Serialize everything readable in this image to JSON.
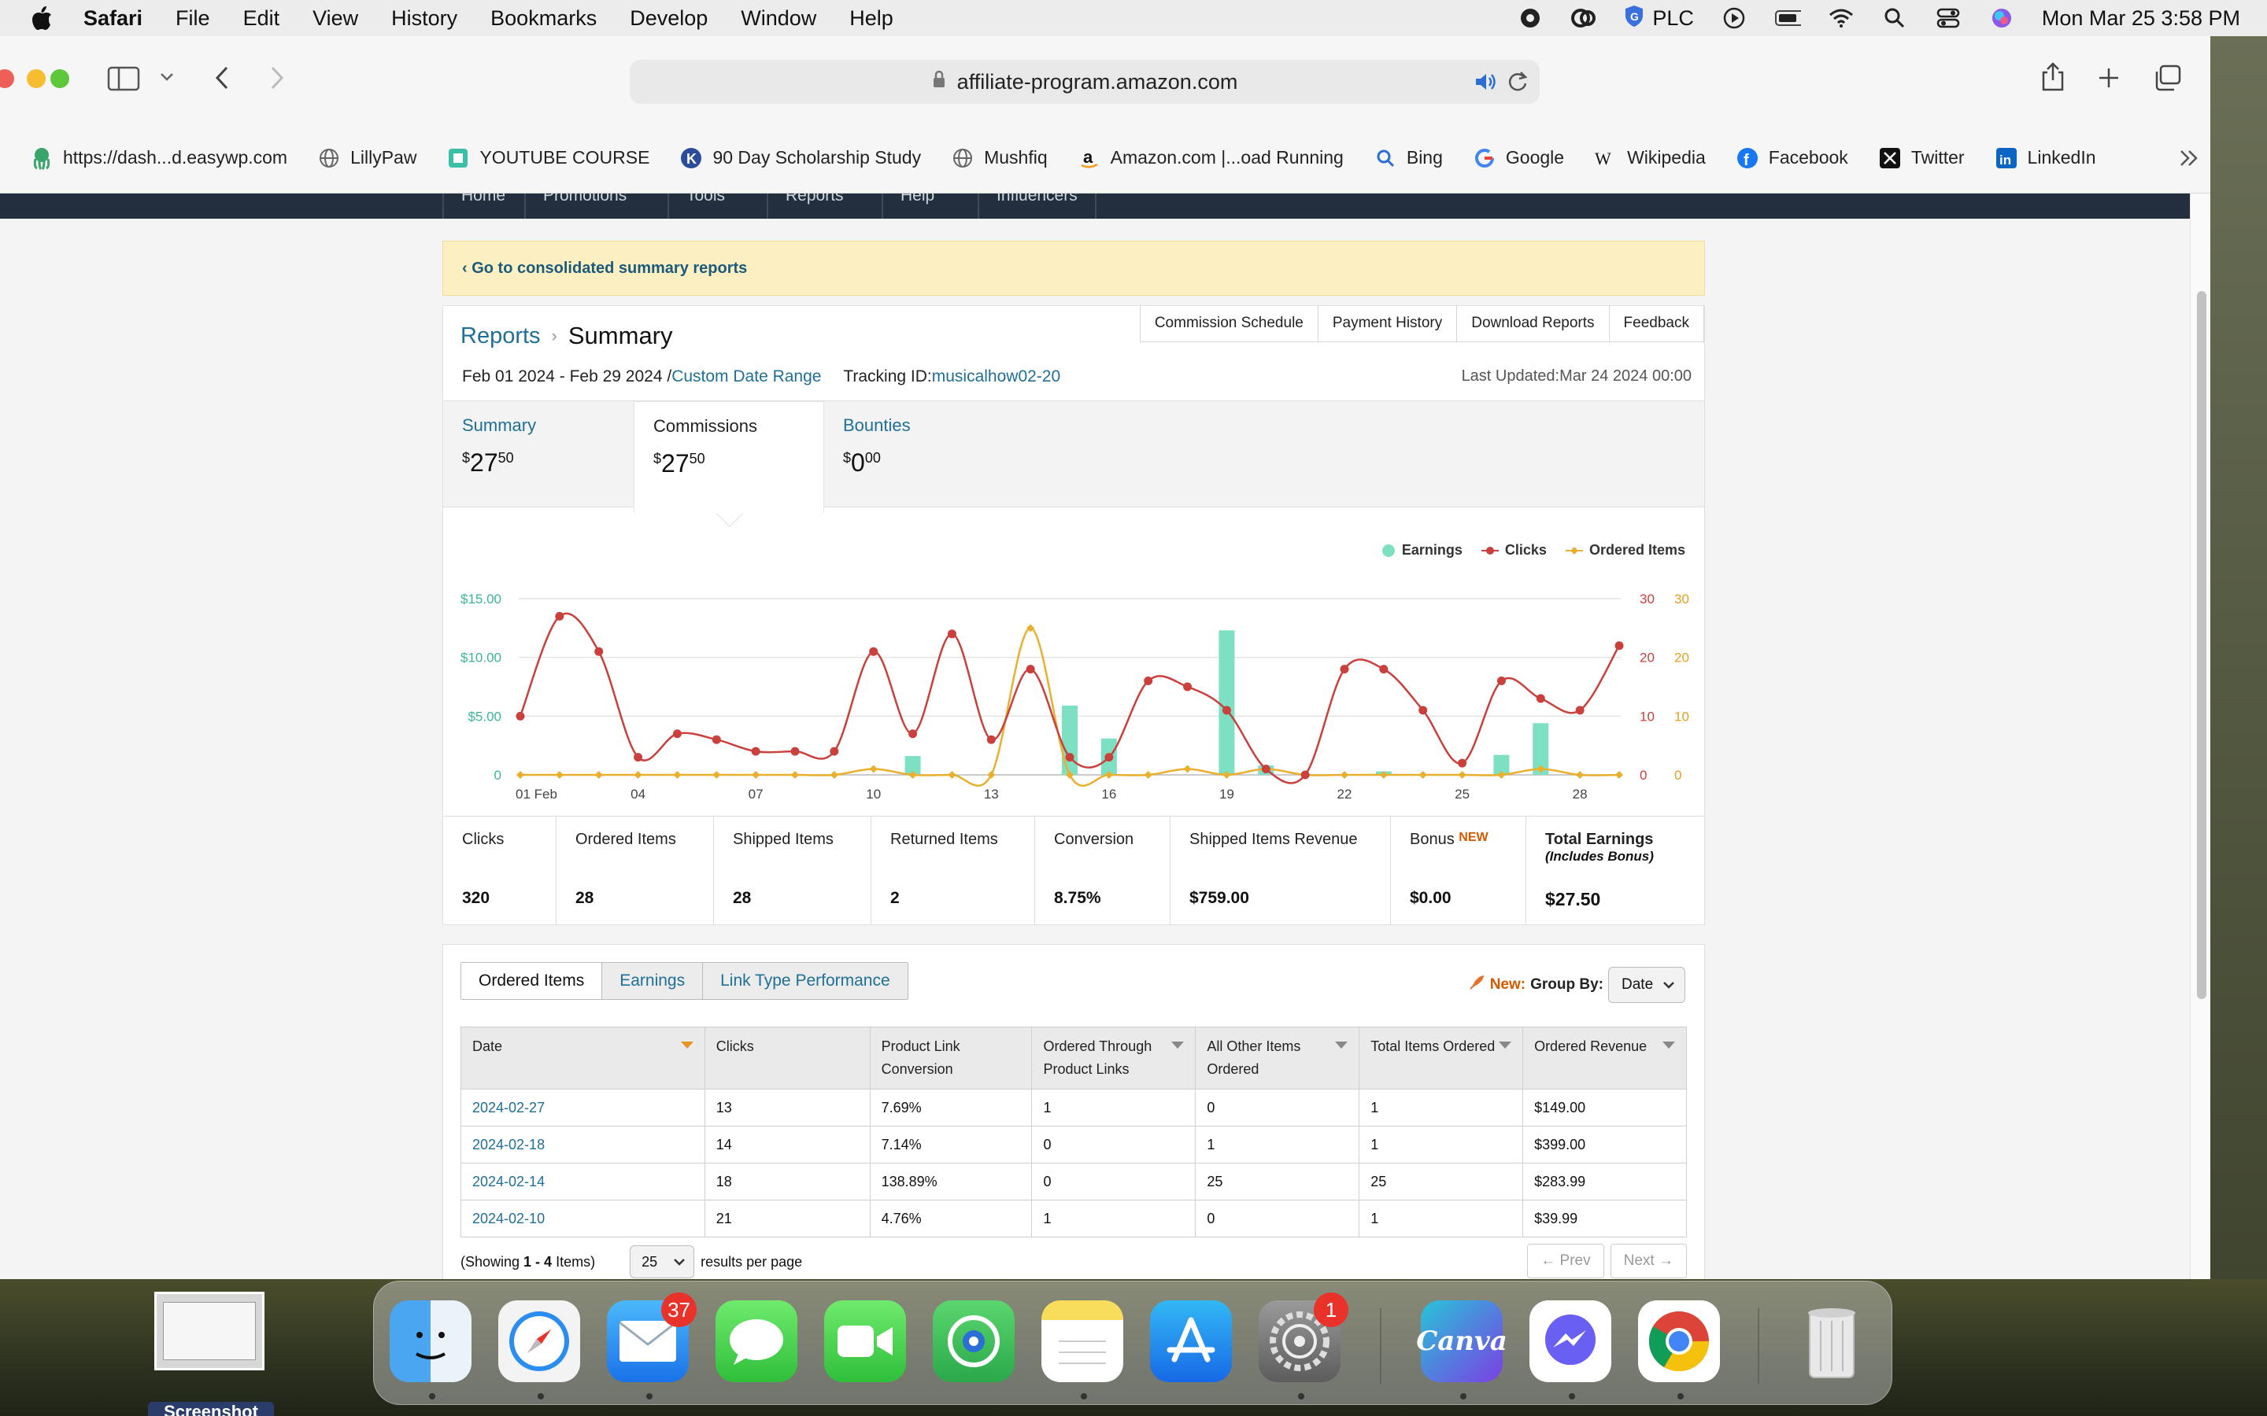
{
  "menubar": {
    "app": "Safari",
    "menus": [
      "File",
      "Edit",
      "View",
      "History",
      "Bookmarks",
      "Develop",
      "Window",
      "Help"
    ],
    "plc_label": "PLC",
    "datetime": "Mon Mar 25  3:58 PM"
  },
  "browser": {
    "url": "affiliate-program.amazon.com",
    "favorites": [
      {
        "label": "https://dash...d.easywp.com",
        "icon": "octopus-icon"
      },
      {
        "label": "LillyPaw",
        "icon": "globe-icon"
      },
      {
        "label": "YOUTUBE COURSE",
        "icon": "bookmark-icon"
      },
      {
        "label": "90 Day Scholarship Study",
        "icon": "k-logo-icon"
      },
      {
        "label": "Mushfiq",
        "icon": "globe-icon"
      },
      {
        "label": "Amazon.com |...oad Running",
        "icon": "amazon-icon"
      },
      {
        "label": "Bing",
        "icon": "search-icon"
      },
      {
        "label": "Google",
        "icon": "google-icon"
      },
      {
        "label": "Wikipedia",
        "icon": "wikipedia-icon"
      },
      {
        "label": "Facebook",
        "icon": "facebook-icon"
      },
      {
        "label": "Twitter",
        "icon": "x-icon"
      },
      {
        "label": "LinkedIn",
        "icon": "linkedin-icon"
      }
    ]
  },
  "nav": [
    "Home",
    "Promotions",
    "Tools",
    "Reports",
    "Help",
    "Influencers"
  ],
  "banner": "‹ Go to consolidated summary reports",
  "report": {
    "crumb_link": "Reports",
    "crumb_current": "Summary",
    "top_buttons": [
      "Commission Schedule",
      "Payment History",
      "Download Reports",
      "Feedback"
    ],
    "date_range": "Feb 01 2024 - Feb 29 2024 /",
    "custom_range": "Custom Date Range",
    "tracking_label": "Tracking ID:",
    "tracking_id": "musicalhow02-20",
    "last_updated": "Last Updated:Mar 24 2024 00:00",
    "tabs": [
      {
        "label": "Summary",
        "dollars": "27",
        "cents": "50"
      },
      {
        "label": "Commissions",
        "dollars": "27",
        "cents": "50"
      },
      {
        "label": "Bounties",
        "dollars": "0",
        "cents": "00"
      }
    ],
    "legend": [
      "Earnings",
      "Clicks",
      "Ordered Items"
    ],
    "metrics": [
      {
        "label": "Clicks",
        "value": "320"
      },
      {
        "label": "Ordered Items",
        "value": "28"
      },
      {
        "label": "Shipped Items",
        "value": "28"
      },
      {
        "label": "Returned Items",
        "value": "2"
      },
      {
        "label": "Conversion",
        "value": "8.75%"
      },
      {
        "label": "Shipped Items Revenue",
        "value": "$759.00"
      },
      {
        "label": "Bonus",
        "badge": "NEW",
        "value": "$0.00"
      },
      {
        "label": "Total Earnings",
        "sub": "(Includes Bonus)",
        "value": "$27.50"
      }
    ]
  },
  "table_panel": {
    "tabs": [
      "Ordered Items",
      "Earnings",
      "Link Type Performance"
    ],
    "new_label": "New:",
    "group_by_label": "Group By:",
    "group_by_value": "Date",
    "headers": [
      "Date",
      "Clicks",
      "Product Link Conversion",
      "Ordered Through Product Links",
      "All Other Items Ordered",
      "Total Items Ordered",
      "Ordered Revenue"
    ],
    "rows": [
      [
        "2024-02-27",
        "13",
        "7.69%",
        "1",
        "0",
        "1",
        "$149.00"
      ],
      [
        "2024-02-18",
        "14",
        "7.14%",
        "0",
        "1",
        "1",
        "$399.00"
      ],
      [
        "2024-02-14",
        "18",
        "138.89%",
        "0",
        "25",
        "25",
        "$283.99"
      ],
      [
        "2024-02-10",
        "21",
        "4.76%",
        "1",
        "0",
        "1",
        "$39.99"
      ]
    ],
    "showing_prefix": "(Showing ",
    "showing_range": "1 - 4",
    "showing_suffix": " Items)",
    "per_page": "25",
    "per_page_label": "results per page",
    "prev": "←  Prev",
    "next": "Next  →"
  },
  "dock": {
    "mail_badge": "37",
    "settings_badge": "1",
    "canva_label": "Canva",
    "screenshot_label": "Screenshot"
  },
  "chart_data": {
    "type": "bar+line",
    "x": [
      "01 Feb",
      "02",
      "03",
      "04",
      "05",
      "06",
      "07",
      "08",
      "09",
      "10",
      "11",
      "12",
      "13",
      "14",
      "15",
      "16",
      "17",
      "18",
      "19",
      "20",
      "21",
      "22",
      "23",
      "24",
      "25",
      "26",
      "27",
      "28",
      "29"
    ],
    "xtick_labels": [
      "01 Feb",
      "04",
      "07",
      "10",
      "13",
      "16",
      "19",
      "22",
      "25",
      "28"
    ],
    "y_left_ticks": [
      "$15.00",
      "$10.00",
      "$5.00",
      "0"
    ],
    "y_right_ticks": [
      "30",
      "20",
      "10",
      "0"
    ],
    "ylim_left": [
      0,
      15
    ],
    "ylim_right": [
      0,
      30
    ],
    "series": [
      {
        "name": "Earnings",
        "type": "bar",
        "axis": "left",
        "color": "#7de0c3",
        "values": [
          0,
          0,
          0,
          0,
          0,
          0,
          0,
          0,
          0,
          0,
          1.6,
          0,
          0,
          0,
          5.9,
          3.1,
          0,
          0,
          12.3,
          0.8,
          0,
          0,
          0.3,
          0,
          0,
          1.7,
          4.4,
          0,
          0
        ]
      },
      {
        "name": "Clicks",
        "type": "line",
        "axis": "right",
        "color": "#c9403c",
        "values": [
          10,
          27,
          21,
          3,
          7,
          6,
          4,
          4,
          4,
          21,
          7,
          24,
          6,
          18,
          3,
          3,
          16,
          15,
          11,
          1,
          0,
          18,
          18,
          11,
          2,
          16,
          13,
          11,
          22
        ]
      },
      {
        "name": "Ordered Items",
        "type": "line",
        "axis": "right",
        "color": "#e9b030",
        "values": [
          0,
          0,
          0,
          0,
          0,
          0,
          0,
          0,
          0,
          1,
          0,
          0,
          0,
          25,
          0,
          0,
          0,
          1,
          0,
          1,
          0,
          0,
          0,
          0,
          0,
          0,
          1,
          0,
          0
        ]
      }
    ]
  }
}
